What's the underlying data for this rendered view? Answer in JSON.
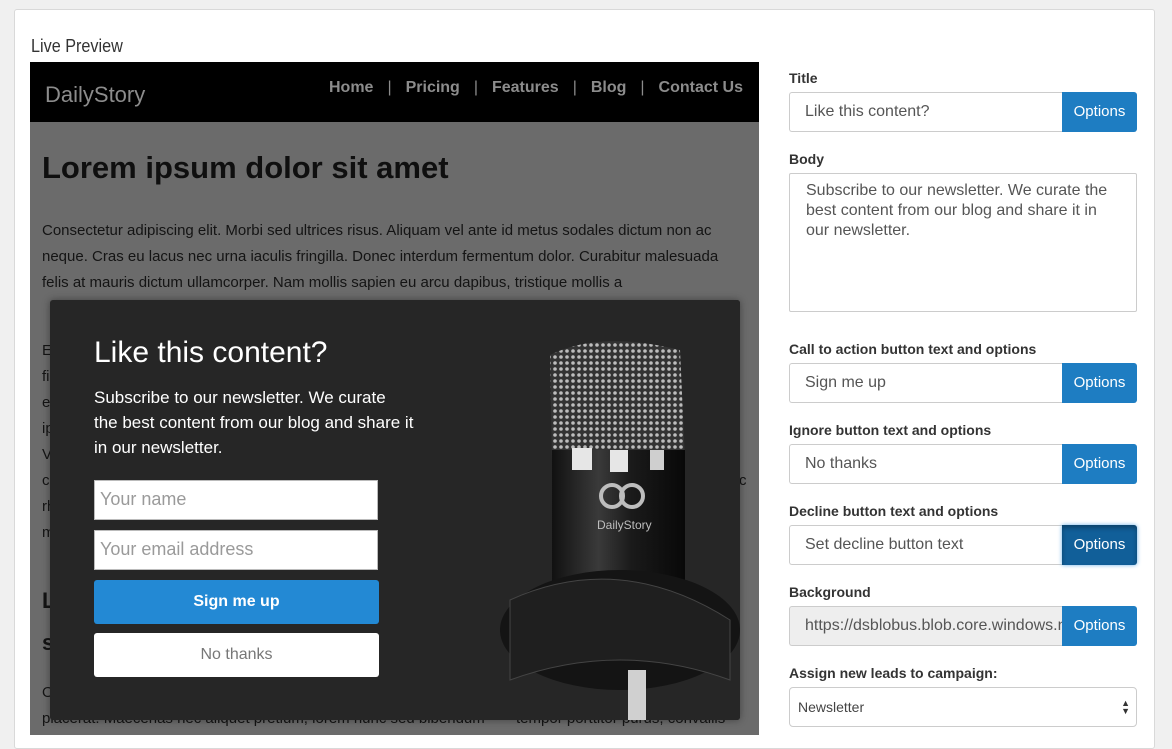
{
  "panel": {
    "title": "Live Preview"
  },
  "preview": {
    "brand": "DailyStory",
    "nav": [
      "Home",
      "Pricing",
      "Features",
      "Blog",
      "Contact Us"
    ],
    "heading": "Lorem ipsum dolor sit amet",
    "paragraph": "Consectetur adipiscing elit. Morbi sed ultrices risus. Aliquam vel ante id metus sodales dictum non ac neque. Cras eu lacus nec urna iaculis fringilla. Donec interdum fermentum dolor. Curabitur malesuada felis at mauris dictum ullamcorper. Nam mollis sapien eu arcu dapibus, tristique mollis a",
    "frag_e": "E",
    "frag_fi": "fi",
    "frag_e2": "e",
    "frag_ip": "ip",
    "frag_v": "V",
    "frag_c": "c",
    "frag_rh": "rh",
    "frag_m": "m",
    "frag_c2": "c",
    "frag_L": "L",
    "frag_s": "s",
    "frag_o": "O",
    "bottom_left": "placerat. Maecenas nec aliquet pretium, lorem nunc sed bibendum",
    "bottom_right": "tempor porttitor purus, convallis"
  },
  "popup": {
    "title": "Like this content?",
    "body": "Subscribe to our newsletter. We curate the best content from our blog and share it in our newsletter.",
    "name_placeholder": "Your name",
    "email_placeholder": "Your email address",
    "cta": "Sign me up",
    "ignore": "No thanks",
    "logo_text": "DailyStory"
  },
  "form": {
    "title_label": "Title",
    "title_value": "Like this content?",
    "body_label": "Body",
    "body_value": "Subscribe to our newsletter. We curate the best content from our blog and share it in our newsletter.",
    "cta_label": "Call to action button text and options",
    "cta_value": "Sign me up",
    "ignore_label": "Ignore button text and options",
    "ignore_value": "No thanks",
    "decline_label": "Decline button text and options",
    "decline_placeholder": "Set decline button text",
    "background_label": "Background",
    "background_value": "https://dsblobus.blob.core.windows.net",
    "campaign_label": "Assign new leads to campaign:",
    "campaign_value": "Newsletter",
    "options": "Options"
  },
  "colors": {
    "accent": "#1e7dc2",
    "popup_bg": "#262626",
    "cta": "#2389d4"
  }
}
